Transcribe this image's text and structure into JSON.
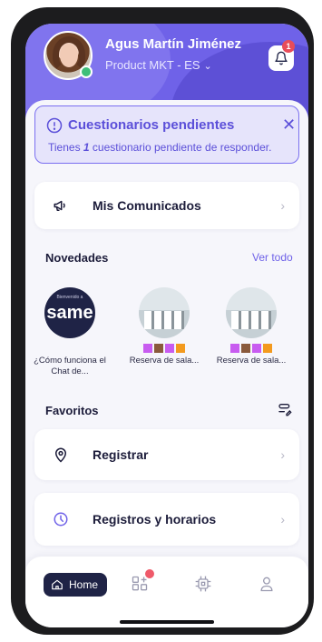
{
  "header": {
    "user_name": "Agus Martín Jiménez",
    "user_role": "Product MKT - ES",
    "notification_count": "1"
  },
  "alert": {
    "title": "Cuestionarios pendientes",
    "text_prefix": "Tienes ",
    "count": "1",
    "text_suffix": " cuestionario pendiente de responder."
  },
  "comunicados": {
    "label": "Mis Comunicados"
  },
  "novedades": {
    "title": "Novedades",
    "see_all": "Ver todo",
    "items": [
      {
        "label": "¿Cómo funciona el Chat de...",
        "brand": "same"
      },
      {
        "label": "Reserva de sala..."
      },
      {
        "label": "Reserva de sala..."
      }
    ]
  },
  "favoritos": {
    "title": "Favoritos",
    "items": [
      {
        "label": "Registrar"
      },
      {
        "label": "Registros y horarios"
      }
    ]
  },
  "bottom_nav": {
    "home_label": "Home"
  },
  "colors": {
    "accent": "#6f62e8",
    "alert_bg": "#e6e4fb",
    "nav_active": "#1f2346",
    "badge": "#e84c5a",
    "swatch_purple": "#c85cf0",
    "swatch_brown": "#8a5a3c",
    "swatch_orange": "#f39a1e"
  }
}
